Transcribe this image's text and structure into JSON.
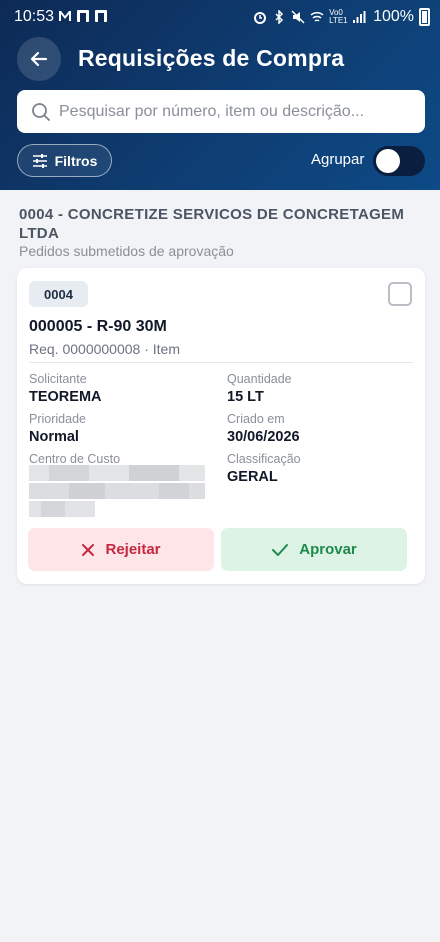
{
  "status_bar": {
    "time": "10:53",
    "network_label": "Vo0 LTE1",
    "battery": "100%"
  },
  "header": {
    "title": "Requisições de Compra",
    "search_placeholder": "Pesquisar por número, item ou descrição...",
    "filter_label": "Filtros",
    "group_label": "Agrupar",
    "group_enabled": false
  },
  "section": {
    "title": "0004 - CONCRETIZE SERVICOS DE CONCRETAGEM LTDA",
    "subtitle": "Pedidos submetidos de aprovação"
  },
  "card": {
    "badge": "0004",
    "item_title": "000005 - R-90 30M",
    "item_subtitle": "Req. 0000000008 · Item",
    "fields": {
      "solicitante_label": "Solicitante",
      "solicitante_value": "TEOREMA",
      "quantidade_label": "Quantidade",
      "quantidade_value": "15 LT",
      "prioridade_label": "Prioridade",
      "prioridade_value": "Normal",
      "criado_label": "Criado em",
      "criado_value": "30/06/2026",
      "centro_label": "Centro de Custo",
      "classificacao_label": "Classificação",
      "classificacao_value": "GERAL"
    },
    "reject_label": "Rejeitar",
    "approve_label": "Aprovar"
  },
  "colors": {
    "header_bg": "#0e3d72",
    "reject": "#c62841",
    "approve": "#1f8a4c"
  }
}
